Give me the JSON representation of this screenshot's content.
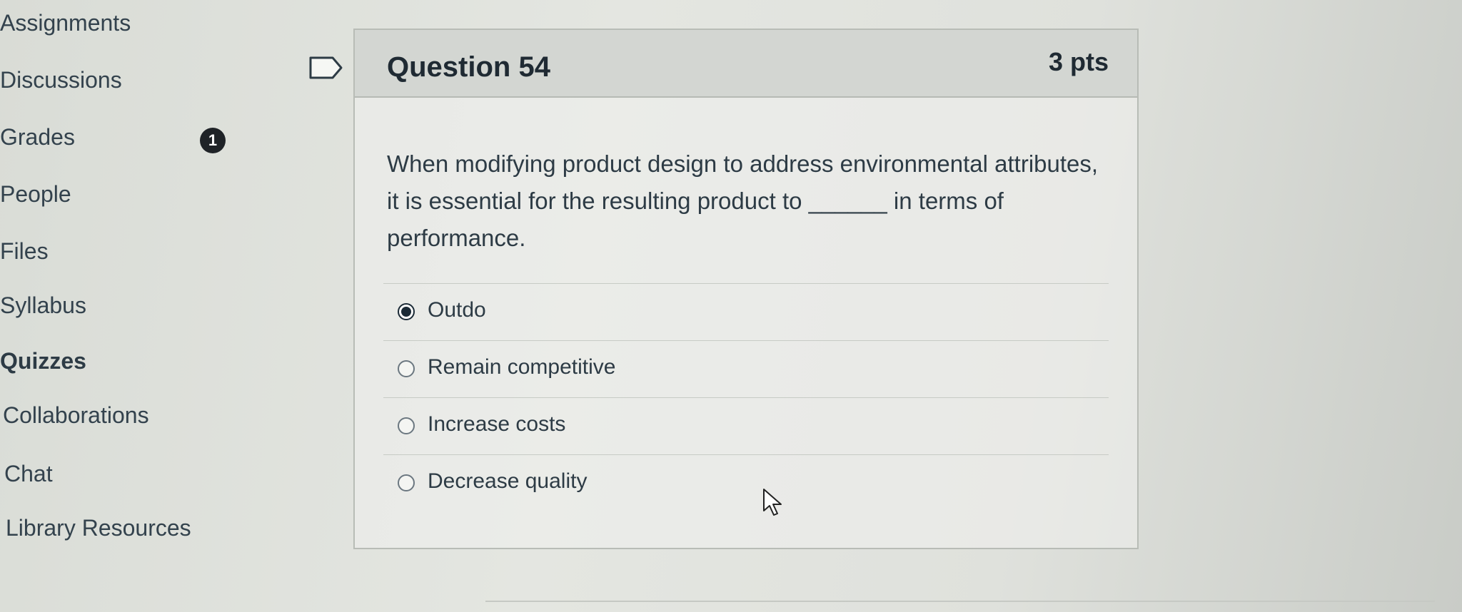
{
  "nav": {
    "items": [
      {
        "label": "Assignments"
      },
      {
        "label": "Discussions"
      },
      {
        "label": "Grades",
        "badge": "1"
      },
      {
        "label": "People"
      },
      {
        "label": "Files"
      },
      {
        "label": "Syllabus"
      },
      {
        "label": "Quizzes",
        "active": true
      },
      {
        "label": "Collaborations"
      },
      {
        "label": "Chat"
      },
      {
        "label": "Library Resources"
      }
    ]
  },
  "question": {
    "title": "Question 54",
    "points": "3 pts",
    "text": "When modifying product design to address environmental attributes, it is essential for the resulting product to ______ in terms of performance.",
    "answers": [
      {
        "label": "Outdo",
        "selected": true
      },
      {
        "label": "Remain competitive",
        "selected": false
      },
      {
        "label": "Increase costs",
        "selected": false
      },
      {
        "label": "Decrease quality",
        "selected": false
      }
    ]
  },
  "icons": {
    "flag": "flag-icon",
    "cursor": "mouse-cursor-icon"
  },
  "colors": {
    "selected_radio": "#1b2a36",
    "badge": "#1f2327",
    "header_bg": "#d3d6d2"
  }
}
